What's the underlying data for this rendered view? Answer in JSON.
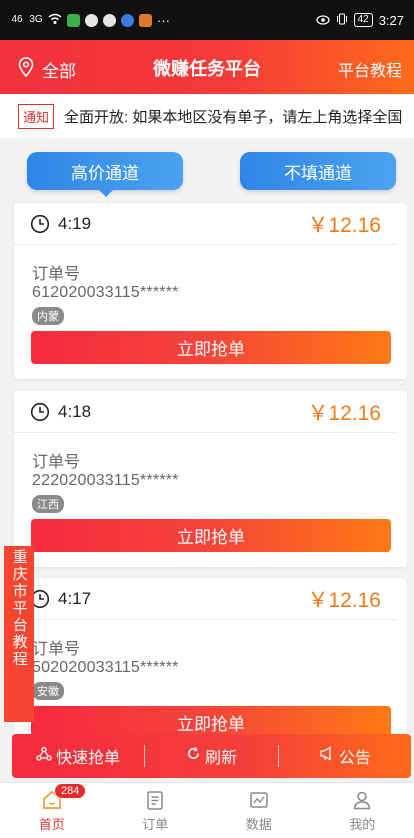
{
  "status_bar": {
    "signal_left": "46",
    "signal_right": "3G",
    "more": "···",
    "battery": "42",
    "time": "3:27"
  },
  "header": {
    "location": "全部",
    "title": "微赚任务平台",
    "tutorial": "平台教程"
  },
  "notice": {
    "tag": "通知",
    "text": "全面开放: 如果本地区没有单子，请左上角选择全国"
  },
  "channels": {
    "high": "高价通道",
    "nofill": "不填通道"
  },
  "orders": [
    {
      "time": "4:19",
      "price": "￥12.16",
      "label": "订单号",
      "order_no": "612020033115******",
      "region": "内蒙",
      "button": "立即抢单"
    },
    {
      "time": "4:18",
      "price": "￥12.16",
      "label": "订单号",
      "order_no": "222020033115******",
      "region": "江西",
      "button": "立即抢单"
    },
    {
      "time": "4:17",
      "price": "￥12.16",
      "label": "订单号",
      "order_no": "502020033115******",
      "region": "安徽",
      "button": "立即抢单"
    }
  ],
  "side_tab": {
    "text": "重庆市平台教程"
  },
  "action_bar": {
    "quick": "快速抢单",
    "refresh": "刷新",
    "announce": "公告"
  },
  "tabbar": {
    "badge": "284",
    "items": [
      {
        "label": "首页"
      },
      {
        "label": "订单"
      },
      {
        "label": "数据"
      },
      {
        "label": "我的"
      }
    ]
  },
  "colors": {
    "accent_red": "#f53a3a",
    "accent_orange": "#ff6a1a",
    "channel_blue": "#3a93ea",
    "price_orange": "#f07a1a"
  }
}
